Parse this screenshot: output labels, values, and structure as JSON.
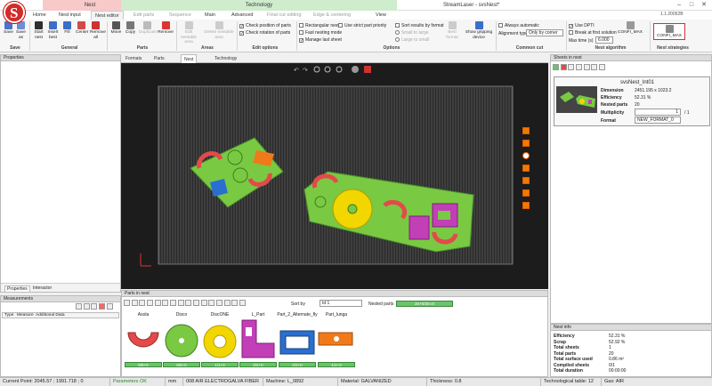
{
  "app": {
    "title": "StreamLaser - svsNest*",
    "version": "1.1.20052B",
    "context_tabs": {
      "nest": "Nest",
      "technology": "Technology"
    }
  },
  "ribbon_tabs": [
    {
      "label": "Home",
      "state": "normal"
    },
    {
      "label": "Nest input",
      "state": "normal"
    },
    {
      "label": "Nest editor",
      "state": "normal"
    },
    {
      "label": "Edit parts",
      "state": "disabled"
    },
    {
      "label": "Sequence",
      "state": "disabled"
    },
    {
      "label": "Main",
      "state": "normal"
    },
    {
      "label": "Advanced",
      "state": "normal"
    },
    {
      "label": "Final cut editing",
      "state": "disabled"
    },
    {
      "label": "Edge & centering",
      "state": "disabled"
    },
    {
      "label": "View",
      "state": "normal"
    }
  ],
  "ribbon": {
    "save": {
      "save": "Save",
      "save_as": "Save as",
      "group": "Save"
    },
    "general": {
      "start_nest": "Start nest",
      "insert_best": "Insert best",
      "fill": "Fill",
      "center": "Center",
      "remove_all": "Remove all",
      "group": "General"
    },
    "parts": {
      "move": "Move",
      "copy": "Copy",
      "duplicate": "Duplicate",
      "remove": "Remove",
      "group": "Parts"
    },
    "areas": {
      "edit_nestable": "Edit nestable area",
      "delete_nestable": "Delete nestable area",
      "group": "Areas"
    },
    "edit_options": {
      "check_position": "Check position of parts",
      "check_rotation": "Check rotation of parts",
      "group": "Edit options"
    },
    "options": {
      "rectangular_nest": "Rectangular nest",
      "fast_nesting": "Fast nesting mode",
      "manage_last_sheet": "Manage last sheet",
      "strict_priority": "Use strict part priority",
      "sort_by_format": "Sort results by format",
      "small_to_large": "Small to large",
      "large_to_small": "Large to small",
      "best_format": "Best format",
      "show_gripping": "Show gripping device",
      "group": "Options"
    },
    "common_cut": {
      "always_automatic": "Always automatic",
      "alignment_type_label": "Alignment type",
      "alignment_type_value": "Only by corner",
      "group": "Common cut"
    },
    "nest_algorithm": {
      "use_dpti": "Use DPTI",
      "break_first": "Break at first solution",
      "max_time_label": "Max time (s)",
      "max_time_value": "6.000",
      "conf": "CONFI_MAX",
      "group": "Nest algorithm"
    },
    "nest_strategies": {
      "conf": "CONFI_MAX",
      "group": "Nest strategies"
    }
  },
  "panels": {
    "properties": "Properties",
    "properties_tabs": [
      "Properties",
      "Interactor"
    ],
    "measurements": "Measurements",
    "measurements_cols": [
      "Type",
      "Measure",
      "Additional Data"
    ],
    "document_tabs": [
      "Formats",
      "Parts",
      "Nest",
      "Technology"
    ],
    "parts_in_nest": "Parts in nest",
    "sheets_in_nest": "Sheets in nest",
    "nest_info": "Nest info"
  },
  "parts_in_nest": {
    "sort_label": "Sort by",
    "sort_value": "Id 1",
    "nested_parts_label": "Nested parts",
    "nested_parts_value": "20+0/20=0",
    "items": [
      {
        "name": "Asola",
        "count": "8/8+0"
      },
      {
        "name": "Disco",
        "count": "5/5+0"
      },
      {
        "name": "DiscONE",
        "count": "1/1+0"
      },
      {
        "name": "L_Part",
        "count": "2/2+0"
      },
      {
        "name": "Part_2_Alternate_fly",
        "count": "2/2+0"
      },
      {
        "name": "Part_lunga",
        "count": "1/1+0"
      }
    ]
  },
  "sheet": {
    "name": "svsNest_Int01",
    "dimension_label": "Dimension",
    "dimension": "2451.195 x 1023.2",
    "efficiency_label": "Efficiency",
    "efficiency": "52.31 %",
    "nested_parts_label": "Nested parts",
    "nested_parts": "20",
    "multiplicity_label": "Multiplicity",
    "multiplicity": "1",
    "multiplicity_of": "/ 1",
    "format_label": "Format",
    "format": "NEW_FORMAT_0"
  },
  "nest_info": [
    {
      "label": "Efficiency",
      "value": "52.31 %"
    },
    {
      "label": "Scrap",
      "value": "52.92 %"
    },
    {
      "label": "Total sheets",
      "value": "1"
    },
    {
      "label": "Total parts",
      "value": "20"
    },
    {
      "label": "Total surface used",
      "value": "0.86 m²"
    },
    {
      "label": "Compiled sheets",
      "value": "0/1"
    },
    {
      "label": "Total duration",
      "value": "00:00:00"
    }
  ],
  "status": {
    "current_point": "Current Point: 2045.57 ; 1991.718 ; 0",
    "parameters": "Parameters OK",
    "units": "mm",
    "material_code": "008 AIR ELECTROGALVA FIBER",
    "machine": "Machine: L_0892",
    "material": "Material: GALVANIZED",
    "thickness": "Thickness: 0.8",
    "tech_table": "Technological table: 12",
    "gas": "Gas: AIR"
  },
  "colors": {
    "accent_red": "#d32a2a",
    "part_green": "#7ac943",
    "part_orange": "#f07a1a",
    "part_yellow": "#f2d600",
    "part_magenta": "#c23fb8",
    "part_blue": "#2a6fd0",
    "part_red": "#e34a4a",
    "count_green": "#6ac46a"
  }
}
